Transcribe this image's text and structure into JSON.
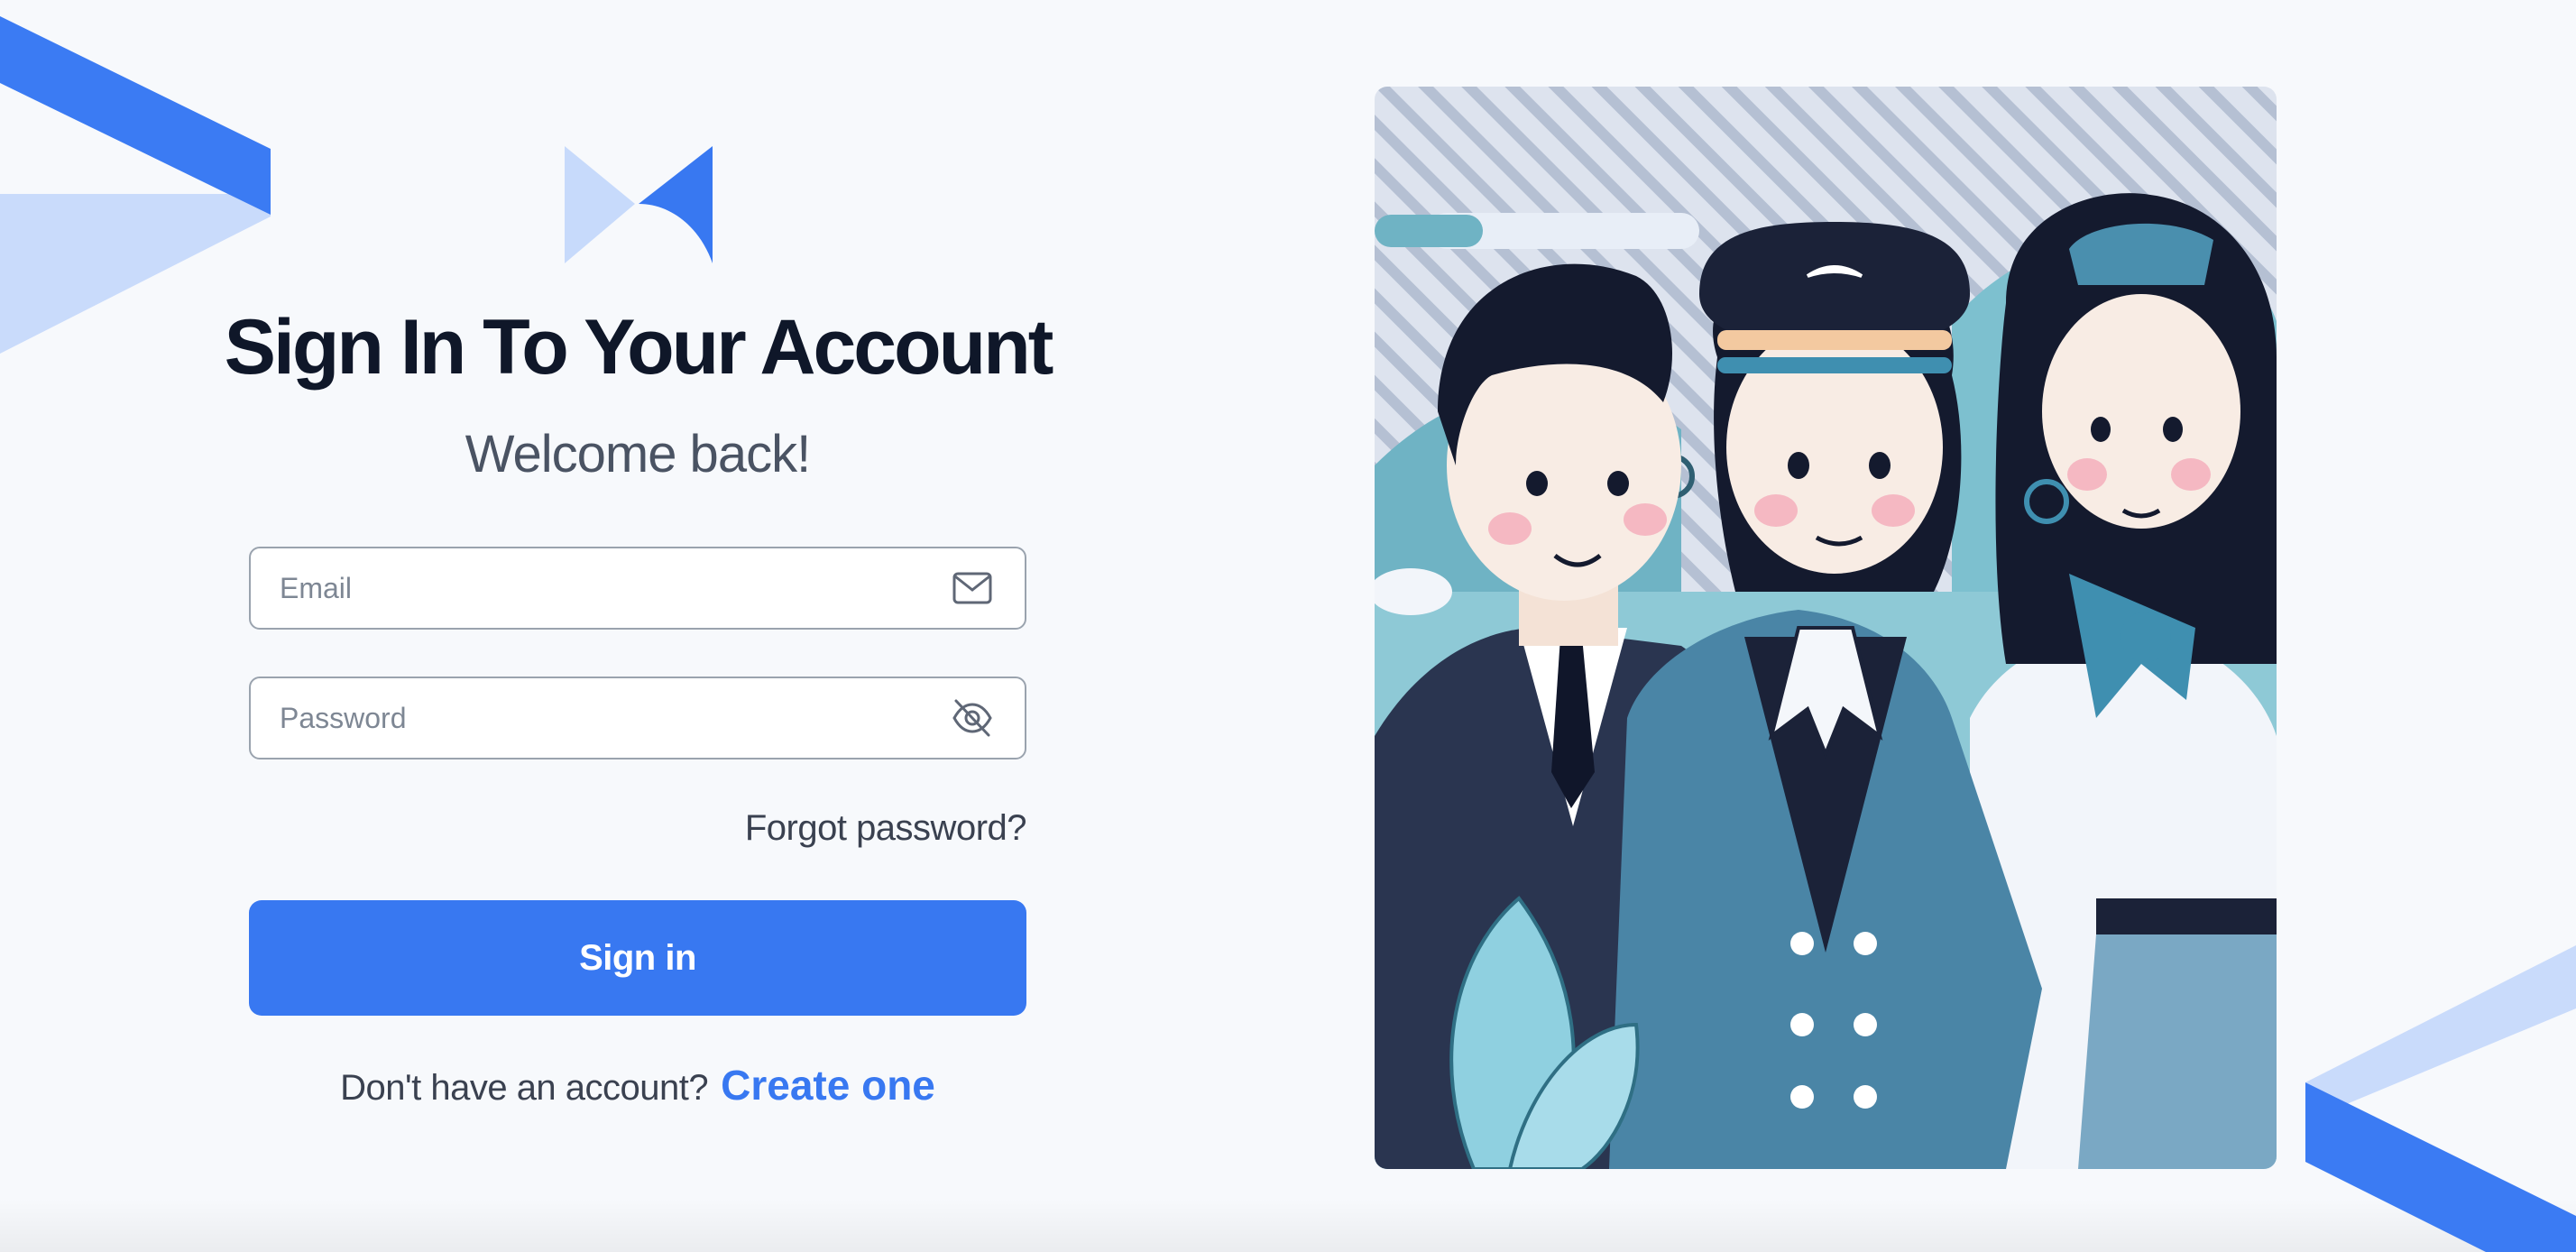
{
  "login": {
    "title": "Sign In To Your Account",
    "subtitle": "Welcome back!",
    "email_placeholder": "Email",
    "password_placeholder": "Password",
    "forgot_password": "Forgot password?",
    "signin_label": "Sign in",
    "no_account_text": "Don't have an account?",
    "create_account_label": "Create one"
  },
  "icons": {
    "logo": "brand-logo",
    "email": "mail-icon",
    "password_toggle": "eye-off-icon"
  },
  "colors": {
    "accent": "#3878f1",
    "accent_light": "#c7dafb",
    "title": "#0f1729",
    "background": "#f7f9fc"
  }
}
